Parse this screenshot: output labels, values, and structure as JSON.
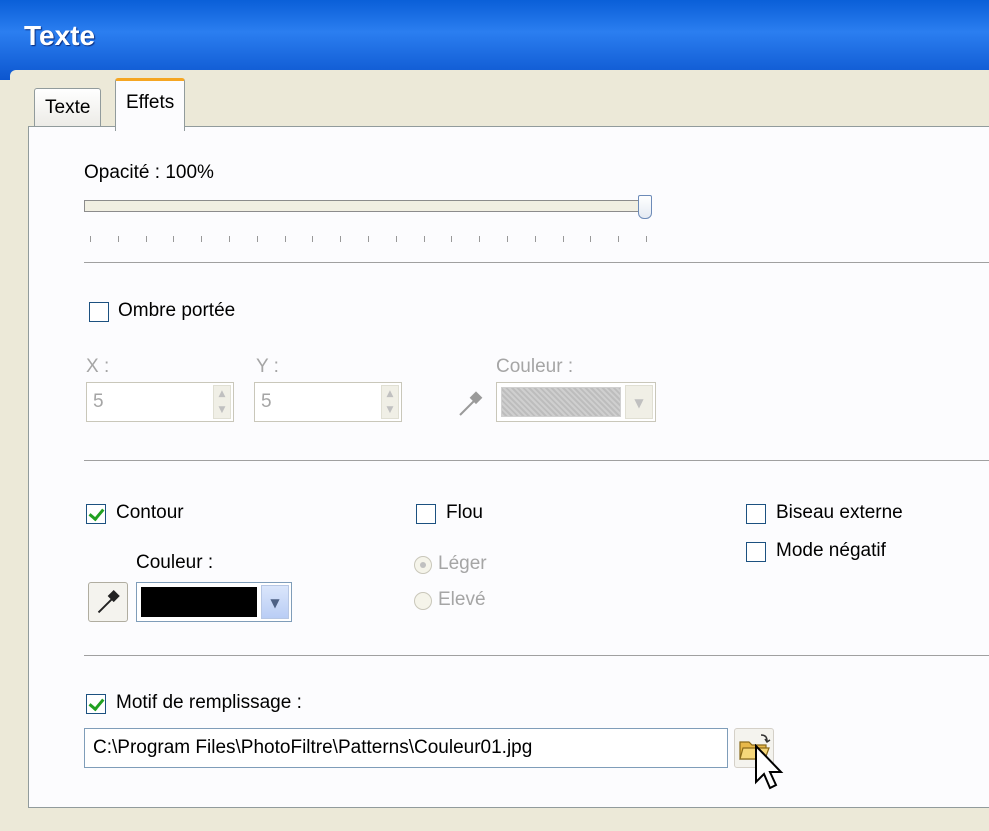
{
  "window": {
    "title": "Texte"
  },
  "tabs": [
    {
      "label": "Texte",
      "active": false
    },
    {
      "label": "Effets",
      "active": true
    }
  ],
  "opacity": {
    "label": "Opacité : 100%",
    "value_percent": 100
  },
  "drop_shadow": {
    "label": "Ombre portée",
    "checked": false,
    "x_label": "X :",
    "x_value": "5",
    "y_label": "Y :",
    "y_value": "5",
    "color_label": "Couleur :"
  },
  "outline": {
    "label": "Contour",
    "checked": true,
    "color_label": "Couleur :",
    "color": "#000000"
  },
  "blur": {
    "label": "Flou",
    "checked": false,
    "options": [
      "Léger",
      "Elevé"
    ],
    "selected": "Léger"
  },
  "bevel": {
    "label": "Biseau externe",
    "checked": false
  },
  "negative": {
    "label": "Mode négatif",
    "checked": false
  },
  "fill_pattern": {
    "label": "Motif de remplissage :",
    "checked": true,
    "path": "C:\\Program Files\\PhotoFiltre\\Patterns\\Couleur01.jpg"
  },
  "icons": {
    "picker": "eyedropper-icon",
    "browse": "open-folder-icon",
    "cursor": "mouse-cursor-icon"
  },
  "colors": {
    "accent_tab": "#f5a623",
    "title_bar": "#0a5fd8",
    "check": "#21a121"
  }
}
